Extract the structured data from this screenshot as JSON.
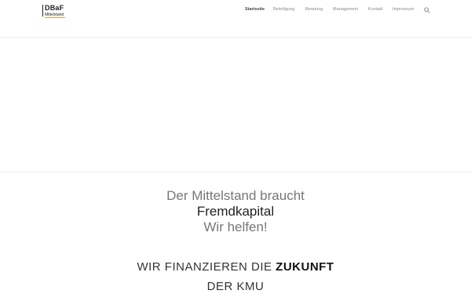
{
  "logo": {
    "main": "DBaF",
    "sub": "Mittelstand"
  },
  "nav": {
    "items": [
      "Startseite",
      "Beteiligung",
      "Beratung",
      "Management",
      "Kontakt",
      "Impressum"
    ],
    "active": "Startseite",
    "search_icon": "search-icon"
  },
  "tagline": {
    "line1": "Der Mittelstand braucht",
    "line2": "Fremdkapital",
    "line3": "Wir helfen!"
  },
  "section": {
    "title_prefix": "WIR FINANZIEREN DIE",
    "title_bold": "ZUKUNFT",
    "subtitle": "DER KMU"
  },
  "colors": {
    "accent": "#e3a03a"
  }
}
